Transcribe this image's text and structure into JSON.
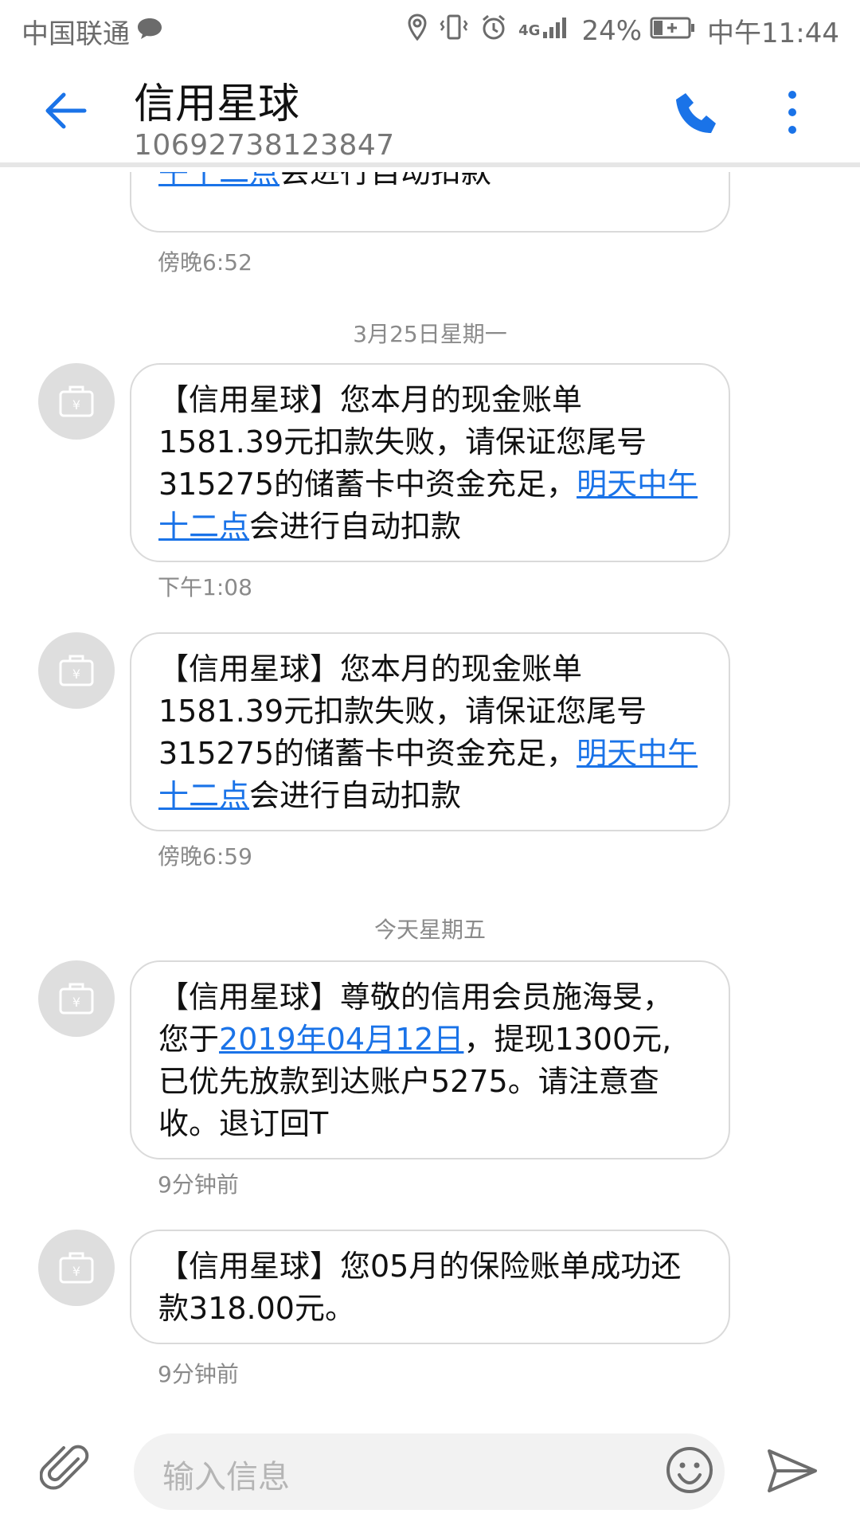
{
  "status_bar": {
    "carrier": "中国联通",
    "signal_label": "4G",
    "battery": "24%",
    "time": "中午11:44"
  },
  "header": {
    "title": "信用星球",
    "number": "10692738123847"
  },
  "messages": [
    {
      "parts": [
        "午十二点",
        "会进行自动扣款"
      ],
      "time": "傍晚6:52",
      "partial": true
    },
    {
      "day": "3月25日星期一"
    },
    {
      "text_before": "【信用星球】您本月的现金账单1581.39元扣款失败，请保证您尾号315275的储蓄卡中资金充足，",
      "link": "明天中午十二点",
      "text_after": "会进行自动扣款",
      "time": "下午1:08"
    },
    {
      "text_before": "【信用星球】您本月的现金账单1581.39元扣款失败，请保证您尾号315275的储蓄卡中资金充足，",
      "link": "明天中午十二点",
      "text_after": "会进行自动扣款",
      "time": "傍晚6:59"
    },
    {
      "day": "今天星期五"
    },
    {
      "text_before": "【信用星球】尊敬的信用会员施海旻，您于",
      "link": "2019年04月12日",
      "text_after": "，提现1300元,已优先放款到达账户5275。请注意查收。退订回T",
      "time": "9分钟前"
    },
    {
      "text_before": "【信用星球】您05月的保险账单成功还款318.00元。",
      "link": "",
      "text_after": "",
      "time": "9分钟前"
    }
  ],
  "input": {
    "placeholder": "输入信息"
  },
  "colors": {
    "accent": "#1a73e8",
    "link": "#1a73e8",
    "avatar_bg": "#dedede"
  }
}
